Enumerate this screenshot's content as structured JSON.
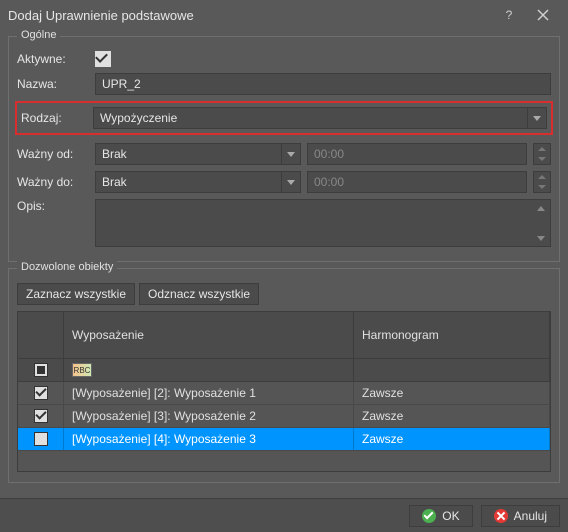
{
  "title": "Dodaj Uprawnienie podstawowe",
  "group_general": "Ogólne",
  "labels": {
    "aktywne": "Aktywne:",
    "nazwa": "Nazwa:",
    "rodzaj": "Rodzaj:",
    "wazny_od": "Ważny od:",
    "wazny_do": "Ważny do:",
    "opis": "Opis:"
  },
  "values": {
    "nazwa": "UPR_2",
    "rodzaj": "Wypożyczenie",
    "wazny_od": "Brak",
    "wazny_do": "Brak",
    "time_od": "00:00",
    "time_do": "00:00",
    "opis": ""
  },
  "group_objects": "Dozwolone obiekty",
  "buttons": {
    "select_all": "Zaznacz wszystkie",
    "deselect_all": "Odznacz wszystkie",
    "ok": "OK",
    "cancel": "Anuluj"
  },
  "grid": {
    "filter_glyph": "RBC",
    "cols": {
      "c2": "Wyposażenie",
      "c3": "Harmonogram"
    },
    "rows": [
      {
        "checked": true,
        "c2": "[Wyposażenie] [2]: Wyposażenie 1",
        "c3": "Zawsze",
        "sel": false
      },
      {
        "checked": true,
        "c2": "[Wyposażenie] [3]: Wyposażenie 2",
        "c3": "Zawsze",
        "sel": false
      },
      {
        "checked": false,
        "c2": "[Wyposażenie] [4]: Wyposażenie 3",
        "c3": "Zawsze",
        "sel": true
      }
    ]
  }
}
